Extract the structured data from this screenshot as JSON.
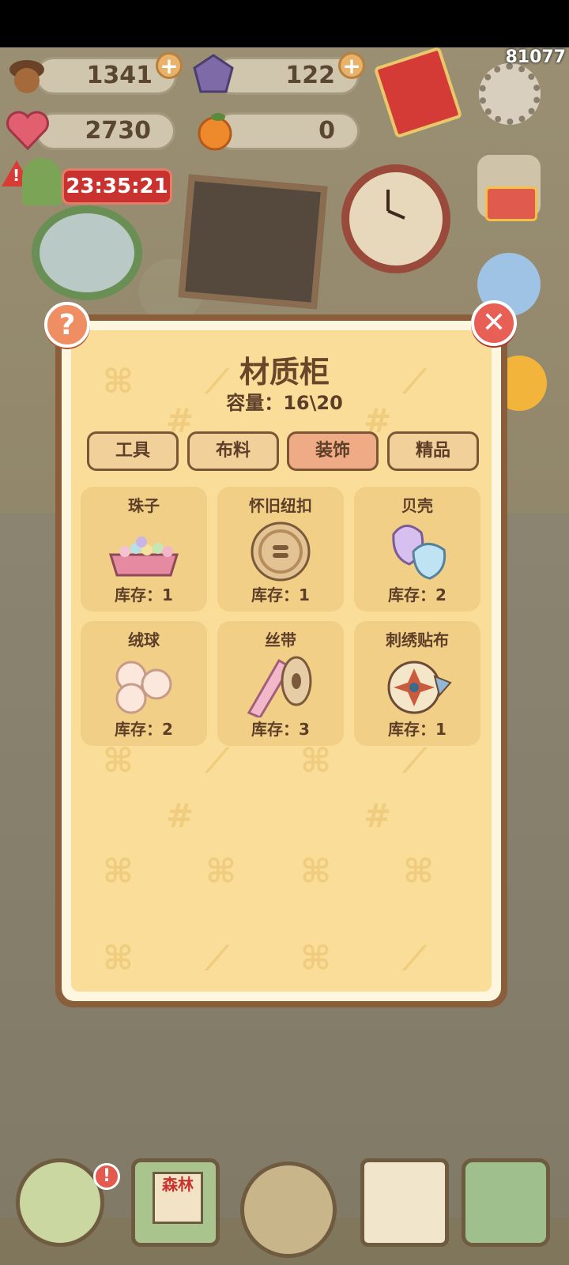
{
  "overlay": {
    "fps_counter": "81077"
  },
  "resources": {
    "acorns": "1341",
    "gems": "122",
    "hearts": "2730",
    "oranges": "0",
    "timer": "23:35:21"
  },
  "modal": {
    "title": "材质柜",
    "capacity": "容量：16\\20",
    "help_label": "?",
    "close_label": "✕",
    "tabs": [
      {
        "label": "工具"
      },
      {
        "label": "布料"
      },
      {
        "label": "装饰",
        "active": true
      },
      {
        "label": "精品"
      }
    ],
    "items": [
      {
        "name": "珠子",
        "stock": "库存：1"
      },
      {
        "name": "怀旧纽扣",
        "stock": "库存：1"
      },
      {
        "name": "贝壳",
        "stock": "库存：2"
      },
      {
        "name": "绒球",
        "stock": "库存：2"
      },
      {
        "name": "丝带",
        "stock": "库存：3"
      },
      {
        "name": "刺绣贴布",
        "stock": "库存：1"
      }
    ]
  },
  "dock": {
    "badge": "!",
    "notebook_label": "森林"
  },
  "colors": {
    "panel_bg": "#f9dd98",
    "panel_border": "#8a5d3b",
    "tab_active": "#eeab86",
    "tab_inactive": "#f1d199",
    "card_bg": "#f2cf86",
    "text_brown": "#5d3f29",
    "timer_red": "#c9322e"
  }
}
